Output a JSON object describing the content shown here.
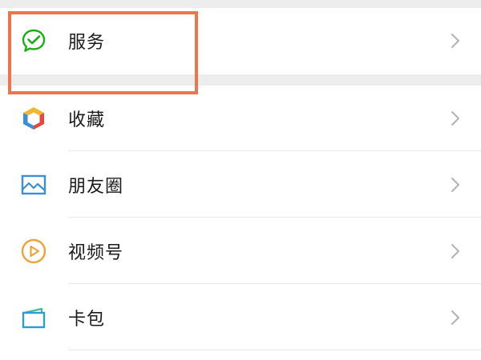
{
  "items": [
    {
      "label": "服务",
      "icon": "wechat-pay-check-icon",
      "color": "#1aad19"
    },
    {
      "label": "收藏",
      "icon": "favorites-cube-icon",
      "color": "#f0b731"
    },
    {
      "label": "朋友圈",
      "icon": "moments-picture-icon",
      "color": "#3b8ed9"
    },
    {
      "label": "视频号",
      "icon": "channels-play-icon",
      "color": "#f0a23a"
    },
    {
      "label": "卡包",
      "icon": "card-wallet-icon",
      "color": "#2d9bd6"
    }
  ],
  "highlight": {
    "color": "#ee7449",
    "target": "服务"
  },
  "colors": {
    "background": "#ffffff",
    "separator": "#ededed",
    "chevron": "#b2b2b2",
    "text": "#1a1a1a"
  }
}
